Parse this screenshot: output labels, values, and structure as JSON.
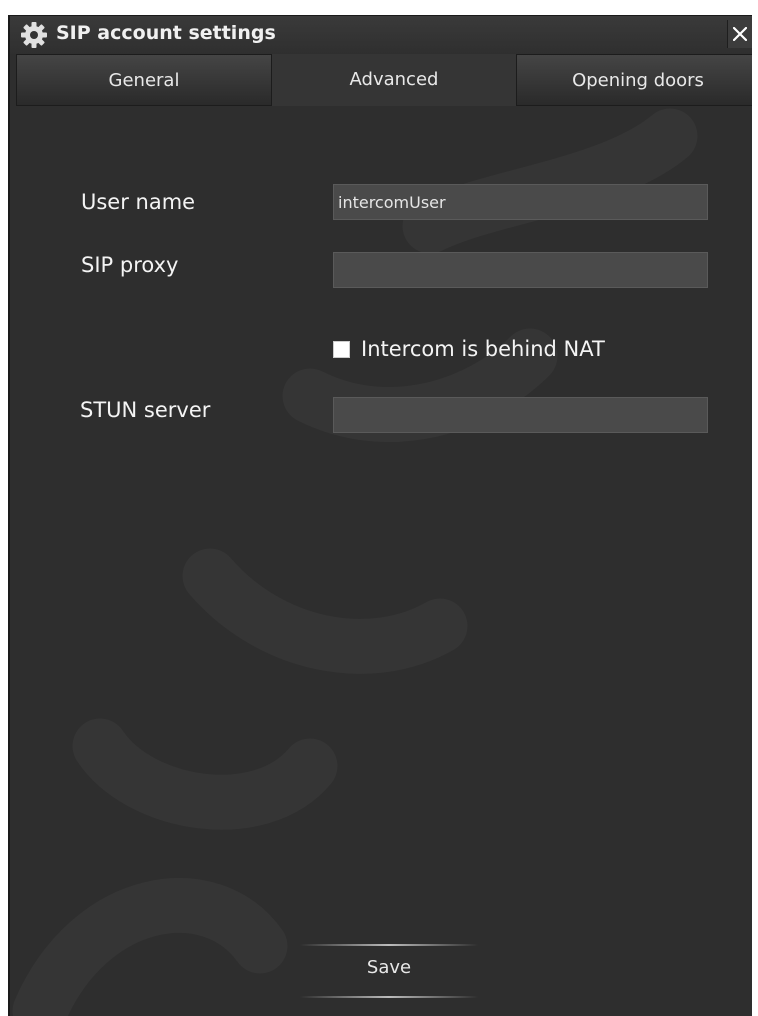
{
  "window": {
    "title": "SIP account settings",
    "title_icon": "gear-icon",
    "close_icon": "close-icon"
  },
  "tabs": [
    {
      "label": "General",
      "active": false
    },
    {
      "label": "Advanced",
      "active": true
    },
    {
      "label": "Opening doors",
      "active": false
    }
  ],
  "form": {
    "user_name_label": "User name",
    "user_name_value": "intercomUser",
    "sip_proxy_label": "SIP proxy",
    "sip_proxy_value": "",
    "nat_checkbox_label": "Intercom is behind NAT",
    "nat_checkbox_checked": false,
    "stun_server_label": "STUN server",
    "stun_server_value": ""
  },
  "actions": {
    "save_label": "Save"
  },
  "colors": {
    "window_bg": "#2e2e2e",
    "field_bg": "#4a4a4a",
    "text": "#f4f4f4"
  }
}
